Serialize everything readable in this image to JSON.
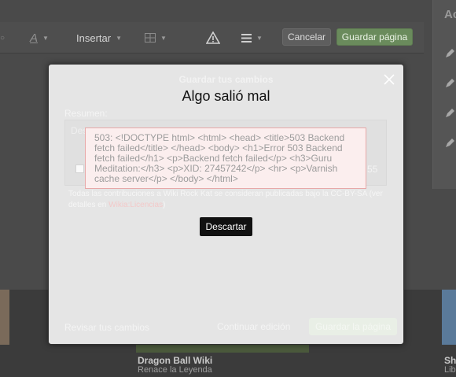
{
  "toolbar": {
    "insert_label": "Insertar",
    "cancel_label": "Cancelar",
    "save_label": "Guardar página"
  },
  "rail": {
    "title": "Ac"
  },
  "below": {
    "card_title": "Dragon Ball Wiki",
    "card_subtitle": "Renace la Leyenda",
    "right_title": "Shi",
    "right_subtitle": "Libe"
  },
  "save_dialog": {
    "title": "Guardar tus cambios",
    "summary_label": "Resumen:",
    "summary_placeholder": "Des",
    "char_count": "55",
    "license_text": "Todas las contribuciones a Wiki Rock Kat se consideran publicadas bajo la CC-BY-SA (ver detalles en ",
    "license_link": "Wikia:Licencias",
    "license_end": ")",
    "review_label": "Revisar tus cambios",
    "continue_label": "Continuar edición",
    "save_label": "Guardar la página"
  },
  "error_dialog": {
    "title": "Algo salió mal",
    "message": "503: <!DOCTYPE html> <html> <head> <title>503 Backend fetch failed</title> </head> <body> <h1>Error 503 Backend fetch failed</h1> <p>Backend fetch failed</p> <h3>Guru Meditation:</h3> <p>XID: 27457242</p> <hr> <p>Varnish cache server</p> </body> </html>",
    "dismiss_label": "Descartar"
  },
  "colors": {
    "page_dim": "#4a4a4a",
    "dialog_bg": "#e5e5e5",
    "error_bg": "#fbeeee",
    "error_border": "#e7a8a8",
    "save_green": "#6a8b5c",
    "dismiss_bg": "#111111"
  }
}
